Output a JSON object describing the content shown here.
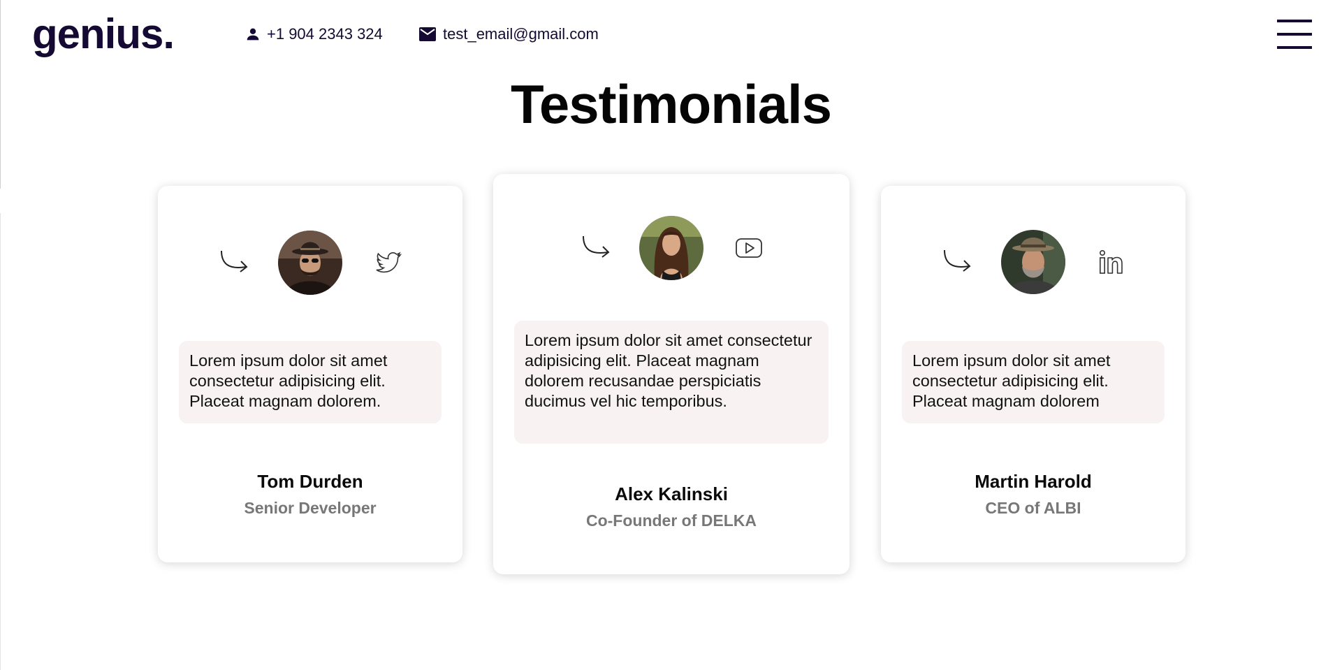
{
  "header": {
    "logo": "genius.",
    "phone": "+1 904 2343 324",
    "email": "test_email@gmail.com"
  },
  "section": {
    "title": "Testimonials"
  },
  "testimonials": [
    {
      "quote": "Lorem ipsum dolor sit amet consectetur adipisicing elit. Placeat magnam dolorem.",
      "name": "Tom Durden",
      "role": "Senior Developer",
      "social_icon": "twitter-icon"
    },
    {
      "quote": "Lorem ipsum dolor sit amet consectetur adipisicing elit. Placeat magnam dolorem recusandae perspiciatis ducimus vel hic temporibus.",
      "name": "Alex Kalinski",
      "role": "Co-Founder of DELKA",
      "social_icon": "youtube-icon"
    },
    {
      "quote": "Lorem ipsum dolor sit amet consectetur adipisicing elit. Placeat magnam dolorem",
      "name": "Martin Harold",
      "role": "CEO of ALBI",
      "social_icon": "linkedin-icon"
    }
  ],
  "colors": {
    "brand": "#150a33",
    "quote_bg": "#f8f2f2",
    "role_text": "#777777"
  }
}
